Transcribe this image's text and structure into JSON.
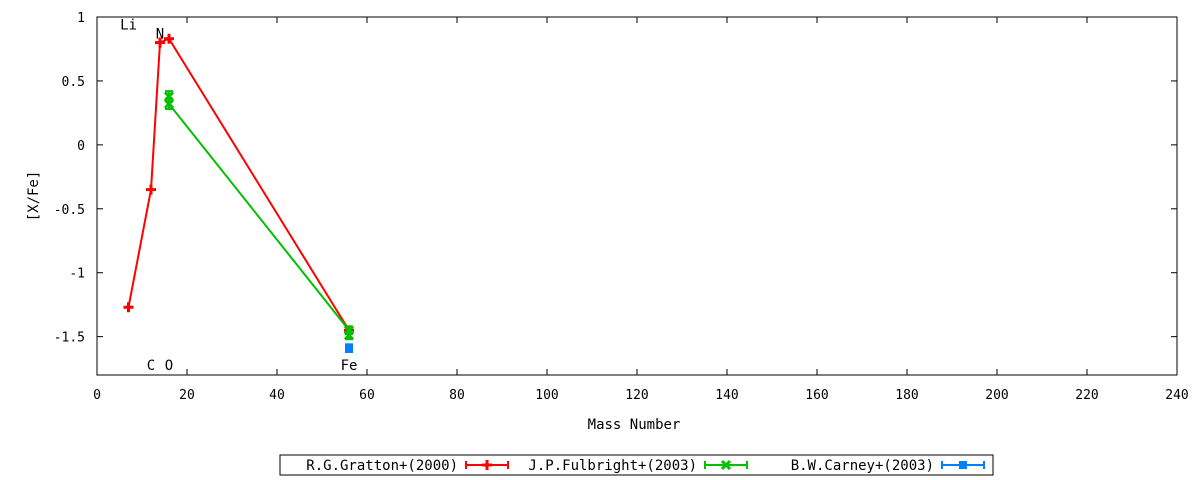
{
  "chart_data": {
    "type": "line",
    "xlabel": "Mass Number",
    "ylabel": "[X/Fe]",
    "xlim": [
      0,
      240
    ],
    "ylim": [
      -1.8,
      1.0
    ],
    "x_ticks": [
      0,
      20,
      40,
      60,
      80,
      100,
      120,
      140,
      160,
      180,
      200,
      220,
      240
    ],
    "y_ticks": [
      1,
      0.5,
      0,
      -0.5,
      -1,
      -1.5
    ],
    "x_tick_labels": [
      "0",
      "20",
      "40",
      "60",
      "80",
      "100",
      "120",
      "140",
      "160",
      "180",
      "200",
      "220",
      "240"
    ],
    "y_tick_labels": [
      "1",
      "0.5",
      "0",
      "-0.5",
      "-1",
      "-1.5"
    ],
    "grid": false,
    "legend_position": "bottom",
    "series": [
      {
        "name": "R.G.Gratton+(2000)",
        "color": "#ff0000",
        "marker": "plus",
        "x": [
          7,
          12,
          14,
          16,
          56
        ],
        "y": [
          -1.27,
          -0.35,
          0.8,
          0.83,
          -1.45
        ],
        "yerr": [
          0,
          0,
          0,
          0,
          0
        ]
      },
      {
        "name": "J.P.Fulbright+(2003)",
        "color": "#00c000",
        "marker": "cross",
        "x": [
          16,
          16,
          56,
          56
        ],
        "y": [
          0.38,
          0.32,
          -1.45,
          -1.49
        ],
        "yerr": [
          0.04,
          0.04,
          0.03,
          0.03
        ]
      },
      {
        "name": "B.W.Carney+(2003)",
        "color": "#0080ff",
        "marker": "square",
        "x": [
          56
        ],
        "y": [
          -1.59
        ],
        "yerr": [
          0.03
        ]
      }
    ],
    "annotations": [
      {
        "text": "Li",
        "x": 7,
        "y": 0.94
      },
      {
        "text": "N",
        "x": 14,
        "y": 0.87
      },
      {
        "text": "C",
        "x": 12,
        "y": -1.72
      },
      {
        "text": "O",
        "x": 16,
        "y": -1.72
      },
      {
        "text": "Fe",
        "x": 56,
        "y": -1.72
      }
    ]
  }
}
